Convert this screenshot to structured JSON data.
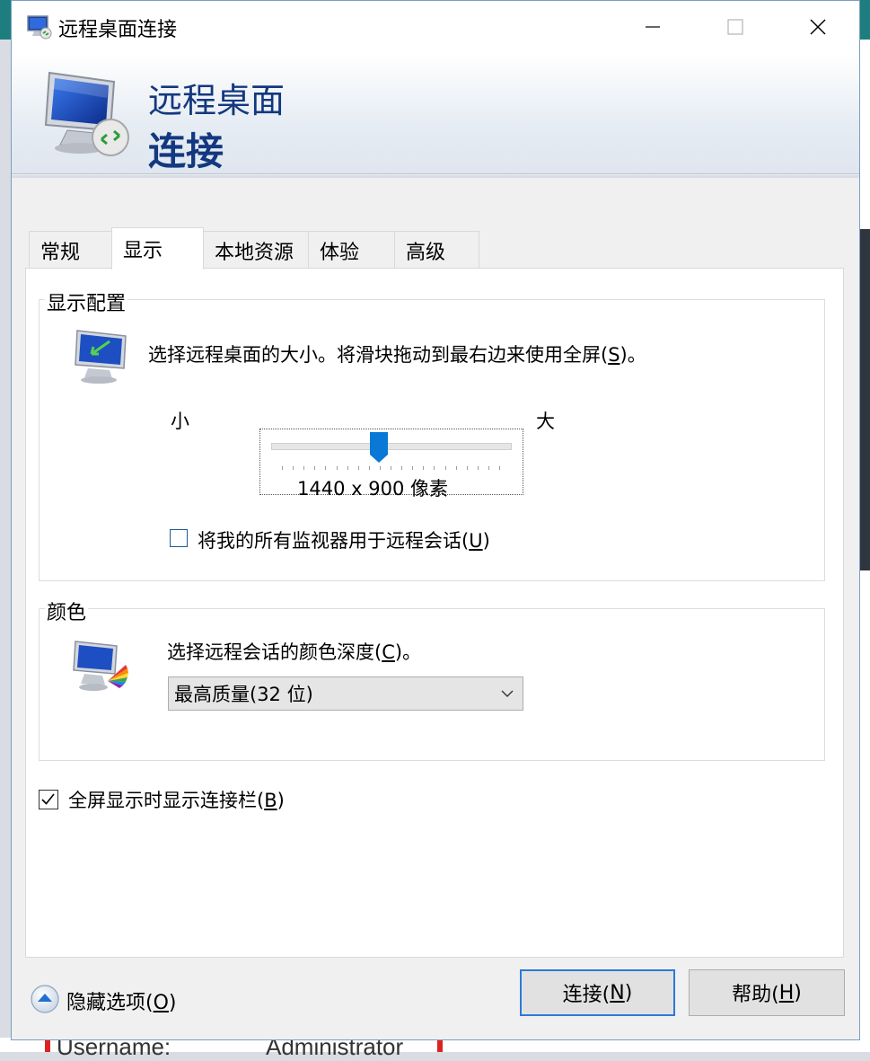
{
  "window": {
    "title": "远程桌面连接",
    "minimize_icon": "minimize-icon",
    "maximize_icon": "maximize-icon",
    "close_icon": "close-icon"
  },
  "banner": {
    "line1": "远程桌面",
    "line2": "连接"
  },
  "tabs": [
    {
      "label": "常规",
      "active": false
    },
    {
      "label": "显示",
      "active": true
    },
    {
      "label": "本地资源",
      "active": false
    },
    {
      "label": "体验",
      "active": false
    },
    {
      "label": "高级",
      "active": false
    }
  ],
  "display_config": {
    "group_label": "显示配置",
    "description": "选择远程桌面的大小。将滑块拖动到最右边来使用全屏(",
    "description_key": "S",
    "description_end": ")。",
    "slider_min_label": "小",
    "slider_max_label": "大",
    "slider_position": 0.45,
    "resolution_text": "1440 x 900 像素",
    "all_monitors_label": "将我的所有监视器用于远程会话(",
    "all_monitors_key": "U",
    "all_monitors_end": ")",
    "all_monitors_checked": false
  },
  "colors": {
    "group_label": "颜色",
    "description": "选择远程会话的颜色深度(",
    "description_key": "C",
    "description_end": ")。",
    "selected": "最高质量(32 位)"
  },
  "connection_bar": {
    "label": "全屏显示时显示连接栏(",
    "key": "B",
    "end": ")",
    "checked": true
  },
  "footer": {
    "hide_options": "隐藏选项(",
    "hide_options_key": "O",
    "hide_options_end": ")",
    "connect": "连接(",
    "connect_key": "N",
    "connect_end": ")",
    "help": "帮助(",
    "help_key": "H",
    "help_end": ")"
  },
  "background": {
    "username_label": "Username:",
    "username_value": "Administrator"
  },
  "colors_theme": {
    "banner_text": "#13387f",
    "accent": "#2c7ad6",
    "slider_thumb": "#0a78d7"
  }
}
